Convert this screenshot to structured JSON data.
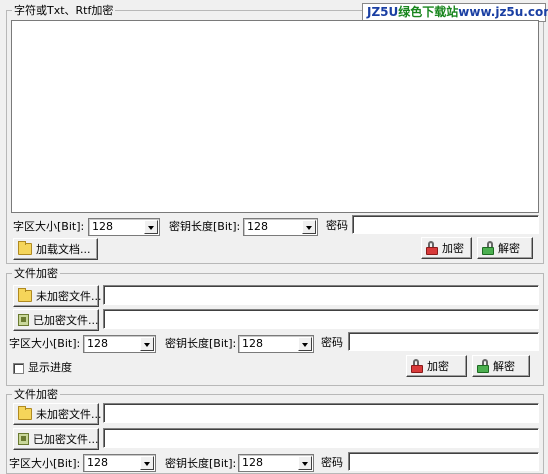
{
  "watermark": {
    "part1": "JZ5U",
    "part2": "绿色下载站",
    "part3": "www.jz5u.com"
  },
  "text_section": {
    "title": "字符或Txt、Rtf加密",
    "block_size_label": "字区大小[Bit]:",
    "block_size_value": "128",
    "key_length_label": "密钥长度[Bit]:",
    "key_length_value": "128",
    "password_label": "密码",
    "password_value": "",
    "load_button": "加载文档...",
    "encrypt_button": "加密",
    "decrypt_button": "解密"
  },
  "file_section_1": {
    "title": "文件加密",
    "unencrypted_button": "未加密文件...",
    "unencrypted_path": "",
    "encrypted_button": "已加密文件...",
    "encrypted_path": "",
    "block_size_label": "字区大小[Bit]:",
    "block_size_value": "128",
    "key_length_label": "密钥长度[Bit]:",
    "key_length_value": "128",
    "password_label": "密码",
    "password_value": "",
    "show_progress_label": "显示进度",
    "show_progress_checked": false,
    "encrypt_button": "加密",
    "decrypt_button": "解密"
  },
  "file_section_2": {
    "title": "文件加密",
    "unencrypted_button": "未加密文件...",
    "unencrypted_path": "",
    "encrypted_button": "已加密文件...",
    "encrypted_path": "",
    "block_size_label": "字区大小[Bit]:",
    "block_size_value": "128",
    "key_length_label": "密钥长度[Bit]:",
    "key_length_value": "128",
    "password_label": "密码",
    "password_value": ""
  }
}
